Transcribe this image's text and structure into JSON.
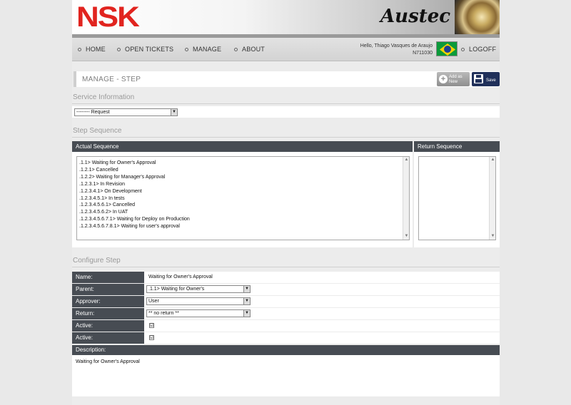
{
  "header": {
    "logo": "NSK",
    "brand": "Austec"
  },
  "nav": {
    "items": [
      {
        "label": "HOME"
      },
      {
        "label": "OPEN TICKETS"
      },
      {
        "label": "MANAGE"
      },
      {
        "label": "ABOUT"
      }
    ],
    "user_greeting": "Hello, Thiago Vasques de Araujo",
    "user_id": "N711030",
    "logoff": "LOGOFF"
  },
  "page": {
    "title": "MANAGE - STEP",
    "add_new_label": "Add as New",
    "save_label": "Save"
  },
  "service_info": {
    "heading": "Service Information",
    "request_select": "-------- Request"
  },
  "step_sequence": {
    "heading": "Step Sequence",
    "actual_header": "Actual Sequence",
    "return_header": "Return Sequence",
    "actual_items": [
      ".1.1> Waiting for Owner's Approval",
      ".1.2.1> Cancelled",
      ".1.2.2> Waiting for Manager's Approval",
      ".1.2.3.1> In Revision",
      ".1.2.3.4.1> On Development",
      ".1.2.3.4.5.1> In tests",
      ".1.2.3.4.5.6.1> Cancelled",
      ".1.2.3.4.5.6.2> In UAT",
      ".1.2.3.4.5.6.7.1> Waiting for Deploy on Production",
      ".1.2.3.4.5.6.7.8.1> Waiting for user's approval"
    ]
  },
  "configure": {
    "heading": "Configure Step",
    "name_label": "Name:",
    "name_value": "Waiting for Owner's Approval",
    "parent_label": "Parent:",
    "parent_value": ".1.1> Waiting for Owner's",
    "approver_label": "Approver:",
    "approver_value": "User",
    "return_label": "Return:",
    "return_value": "** no return **",
    "active1_label": "Active:",
    "active2_label": "Active:",
    "check_mark": "☑",
    "description_label": "Description:",
    "description_value": "Waiting for Owner's Approval"
  },
  "colors": {
    "brand_red": "#e1241f",
    "header_dark": "#474c53",
    "save_blue": "#20305a"
  }
}
